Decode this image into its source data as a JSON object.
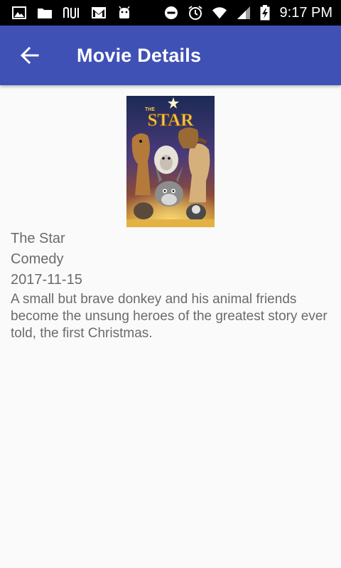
{
  "status_bar": {
    "time": "9:17 PM",
    "icons_left": [
      "gallery-icon",
      "folder-icon",
      "nu-logo-icon",
      "gmail-icon",
      "android-icon"
    ],
    "icons_right": [
      "do-not-disturb-icon",
      "alarm-icon",
      "wifi-icon",
      "signal-icon",
      "battery-charging-icon"
    ]
  },
  "app_bar": {
    "title": "Movie Details",
    "back_icon": "arrow-back-icon",
    "color": "#3f51b5"
  },
  "movie": {
    "title": "The Star",
    "genre": "Comedy",
    "release_date": "2017-11-15",
    "overview": "A small but brave donkey and his animal friends become the unsung heroes of the greatest story ever told, the first Christmas.",
    "poster": {
      "title_text": "STAR",
      "title_prefix": "THE"
    }
  }
}
